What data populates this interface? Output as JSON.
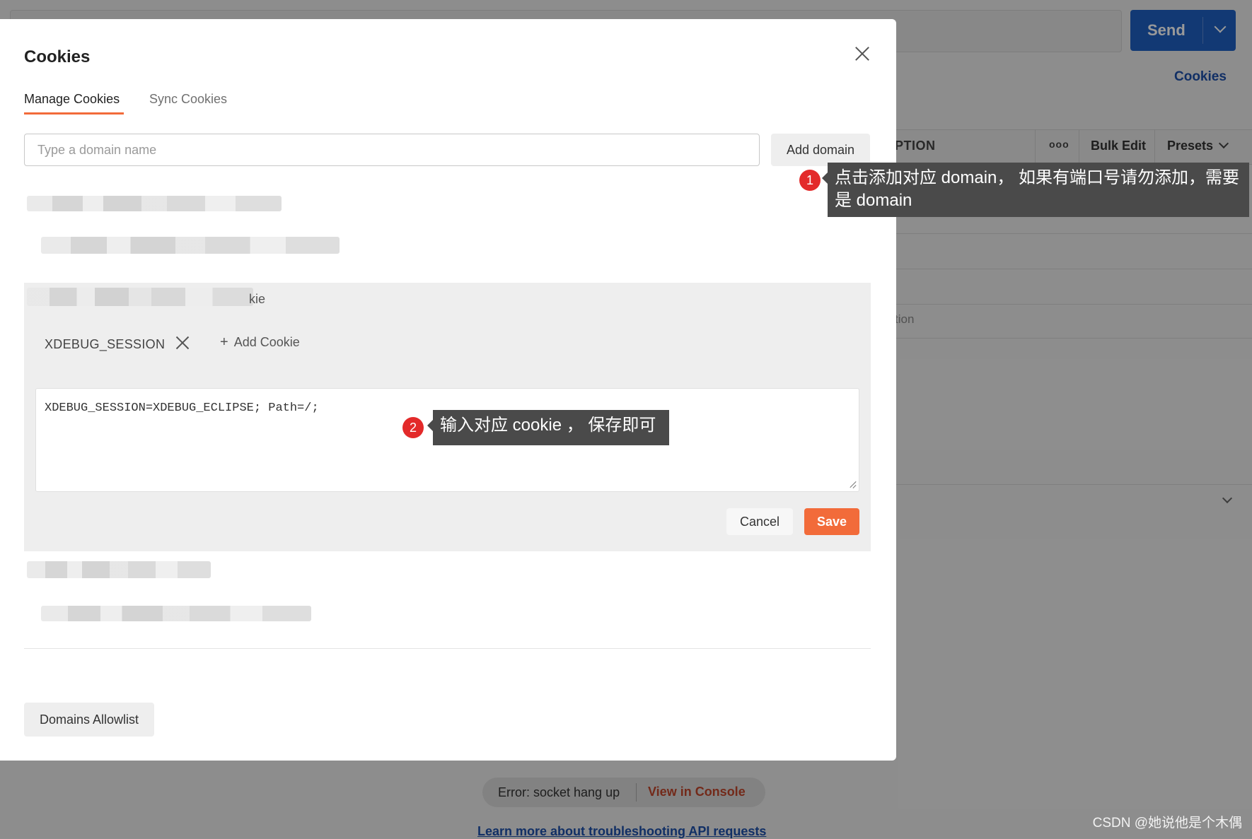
{
  "background": {
    "send_label": "Send",
    "cookies_link": "Cookies",
    "table_header": {
      "description_fragment": "PTION",
      "more_label": "ooo",
      "bulk_edit": "Bulk Edit",
      "presets": "Presets"
    },
    "row_fragment": "tion",
    "error": {
      "message": "Error: socket hang up",
      "view_console": "View in Console"
    },
    "learn_more": "Learn more about troubleshooting API requests"
  },
  "modal": {
    "title": "Cookies",
    "tabs": [
      {
        "label": "Manage Cookies",
        "active": true
      },
      {
        "label": "Sync Cookies",
        "active": false
      }
    ],
    "domain_input": {
      "placeholder": "Type a domain name",
      "value": ""
    },
    "add_domain_label": "Add domain",
    "panel_fragment": "kie",
    "cookie_chip": "XDEBUG_SESSION",
    "add_cookie_label": "Add Cookie",
    "cookie_value": "XDEBUG_SESSION=XDEBUG_ECLIPSE; Path=/;",
    "cancel_label": "Cancel",
    "save_label": "Save",
    "allowlist_label": "Domains Allowlist"
  },
  "annotations": [
    {
      "number": "1",
      "text": "点击添加对应 domain， 如果有端口号请勿添加，需要是 domain"
    },
    {
      "number": "2",
      "text": "输入对应 cookie ， 保存即可"
    }
  ],
  "watermark": "CSDN @她说他是个木偶",
  "colors": {
    "accent": "#f26b3a",
    "send_blue": "#1f5fc2",
    "badge_red": "#e32a2a",
    "tooltip_bg": "#4a4a4a"
  }
}
